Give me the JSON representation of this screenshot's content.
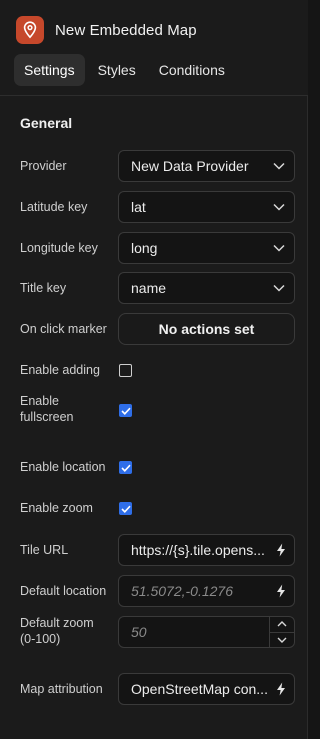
{
  "header": {
    "title": "New Embedded Map",
    "icon": "location-pin-icon",
    "accent": "#c6482b"
  },
  "tabs": [
    {
      "label": "Settings",
      "active": true
    },
    {
      "label": "Styles",
      "active": false
    },
    {
      "label": "Conditions",
      "active": false
    }
  ],
  "general": {
    "title": "General",
    "provider": {
      "label": "Provider",
      "value": "New Data Provider"
    },
    "latitude": {
      "label": "Latitude key",
      "value": "lat"
    },
    "longitude": {
      "label": "Longitude key",
      "value": "long"
    },
    "title_key": {
      "label": "Title key",
      "value": "name"
    },
    "on_click": {
      "label": "On click marker",
      "button": "No actions set"
    },
    "enable_adding": {
      "label": "Enable adding",
      "checked": false
    },
    "enable_fullscreen": {
      "label_line1": "Enable",
      "label_line2": "fullscreen",
      "checked": true
    },
    "enable_location": {
      "label": "Enable location",
      "checked": true
    },
    "enable_zoom": {
      "label": "Enable zoom",
      "checked": true
    },
    "tile_url": {
      "label": "Tile URL",
      "value": "https://{s}.tile.opens..."
    },
    "default_location": {
      "label": "Default location",
      "placeholder": "51.5072,-0.1276"
    },
    "default_zoom": {
      "label_line1": "Default zoom",
      "label_line2": "(0-100)",
      "placeholder": "50"
    },
    "map_attribution": {
      "label": "Map attribution",
      "value": "OpenStreetMap con..."
    }
  },
  "colors": {
    "checkbox_checked": "#2f6ee8"
  }
}
